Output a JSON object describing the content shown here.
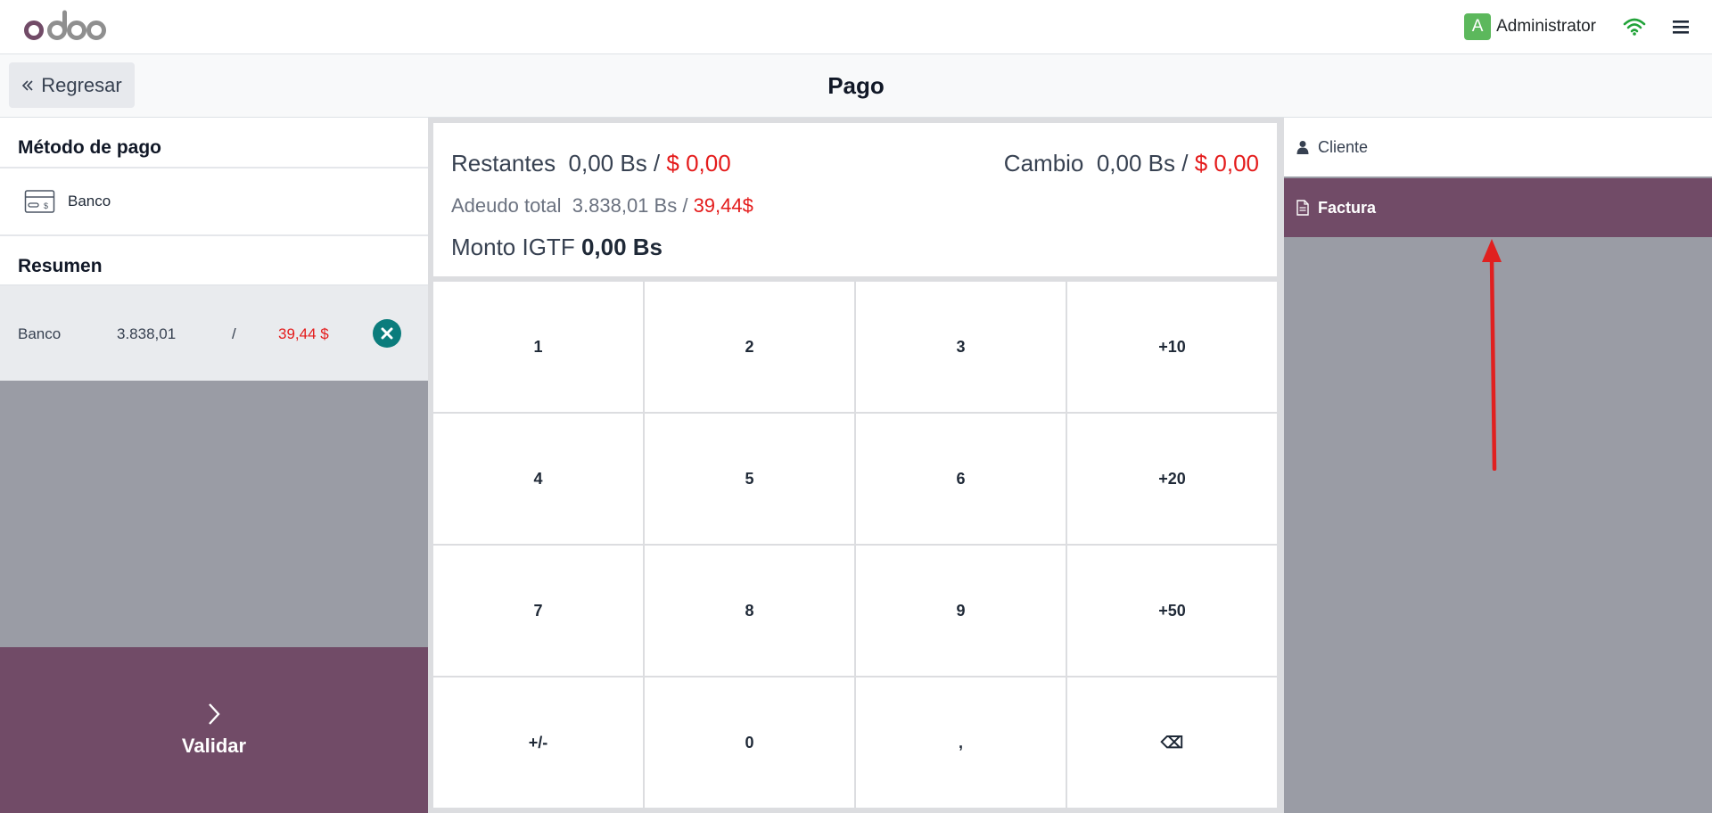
{
  "navbar": {
    "user_initial": "A",
    "user_name": "Administrator"
  },
  "header": {
    "back_label": "Regresar",
    "title": "Pago"
  },
  "left": {
    "payment_method_title": "Método de pago",
    "methods": [
      {
        "label": "Banco",
        "icon": "card-icon"
      }
    ],
    "summary_title": "Resumen",
    "summary_lines": [
      {
        "method": "Banco",
        "amount_bs": "3.838,01",
        "sep": "/",
        "amount_usd": "39,44 $"
      }
    ],
    "validate_label": "Validar"
  },
  "totals": {
    "remaining_label": "Restantes",
    "remaining_bs": "0,00 Bs /",
    "remaining_usd": "$ 0,00",
    "change_label": "Cambio",
    "change_bs": "0,00 Bs /",
    "change_usd": "$ 0,00",
    "due_label": "Adeudo total",
    "due_bs": "3.838,01 Bs /",
    "due_usd": "39,44$",
    "igtf_label": "Monto IGTF",
    "igtf_value": "0,00 Bs"
  },
  "numpad": [
    "1",
    "2",
    "3",
    "+10",
    "4",
    "5",
    "6",
    "+20",
    "7",
    "8",
    "9",
    "+50",
    "+/-",
    "0",
    ",",
    "⌫"
  ],
  "right": {
    "customer_label": "Cliente",
    "invoice_label": "Factura"
  },
  "colors": {
    "brand": "#714b67",
    "accent_red": "#e41b1b",
    "remove_teal": "#0b7c7c",
    "panel_gray": "#9a9ca5",
    "annotation_arrow": "#e02020"
  }
}
